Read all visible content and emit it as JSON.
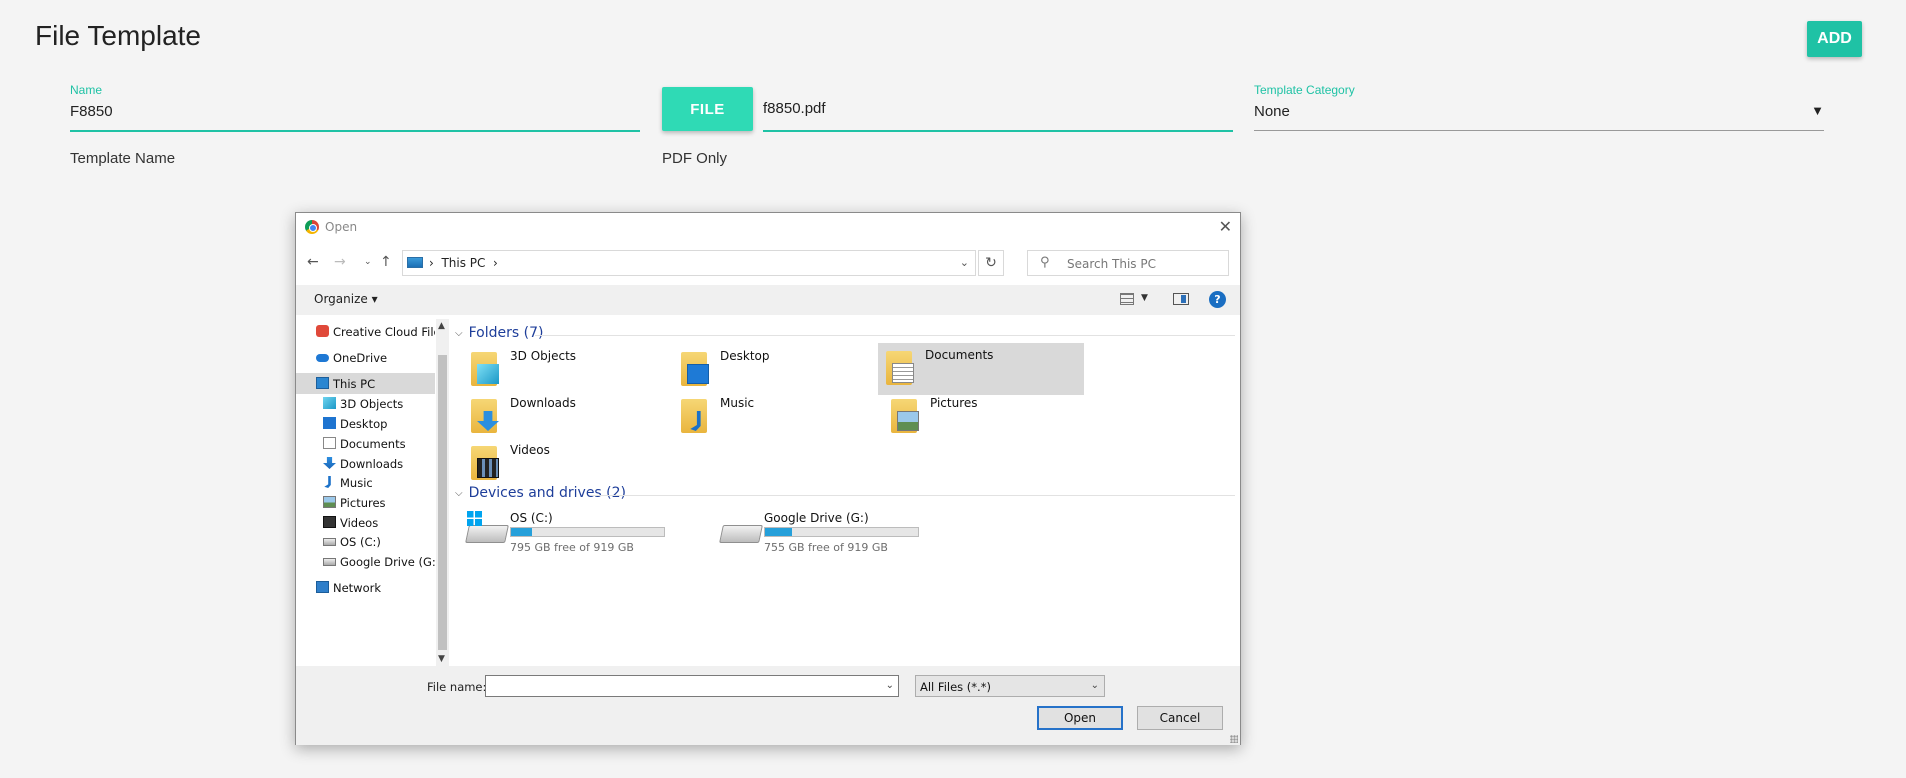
{
  "page": {
    "title": "File Template",
    "add_label": "ADD",
    "accent_color": "#1fc2a5"
  },
  "form": {
    "name_label": "Name",
    "name_value": "F8850",
    "name_hint": "Template Name",
    "file_button": "FILE",
    "file_value": "f8850.pdf",
    "file_hint": "PDF Only",
    "category_label": "Template Category",
    "category_value": "None"
  },
  "dialog": {
    "title": "Open",
    "address": "This PC",
    "search_placeholder": "Search This PC",
    "organize": "Organize",
    "nav_items": [
      {
        "label": "Creative Cloud Files",
        "icon": "creative-cloud-icon",
        "indent": false
      },
      {
        "label": "OneDrive",
        "icon": "onedrive-icon",
        "indent": false
      },
      {
        "label": "This PC",
        "icon": "computer-icon",
        "indent": false,
        "selected": true
      },
      {
        "label": "3D Objects",
        "icon": "3d-objects-icon",
        "indent": true
      },
      {
        "label": "Desktop",
        "icon": "desktop-icon",
        "indent": true
      },
      {
        "label": "Documents",
        "icon": "documents-icon",
        "indent": true
      },
      {
        "label": "Downloads",
        "icon": "downloads-icon",
        "indent": true
      },
      {
        "label": "Music",
        "icon": "music-icon",
        "indent": true
      },
      {
        "label": "Pictures",
        "icon": "pictures-icon",
        "indent": true
      },
      {
        "label": "Videos",
        "icon": "videos-icon",
        "indent": true
      },
      {
        "label": "OS (C:)",
        "icon": "drive-icon",
        "indent": true
      },
      {
        "label": "Google Drive (G:)",
        "icon": "drive-icon",
        "indent": true
      },
      {
        "label": "Network",
        "icon": "network-icon",
        "indent": false
      }
    ],
    "folders_header": "Folders (7)",
    "folders": [
      {
        "label": "3D Objects",
        "icon": "3d-objects-icon"
      },
      {
        "label": "Desktop",
        "icon": "desktop-icon"
      },
      {
        "label": "Documents",
        "icon": "documents-icon",
        "selected": true
      },
      {
        "label": "Downloads",
        "icon": "downloads-icon"
      },
      {
        "label": "Music",
        "icon": "music-icon"
      },
      {
        "label": "Pictures",
        "icon": "pictures-icon"
      },
      {
        "label": "Videos",
        "icon": "videos-icon"
      }
    ],
    "drives_header": "Devices and drives (2)",
    "drives": [
      {
        "label": "OS (C:)",
        "free_text": "795 GB free of 919 GB",
        "used_fraction": 0.135,
        "icon": "windows-drive-icon"
      },
      {
        "label": "Google Drive (G:)",
        "free_text": "755 GB free of 919 GB",
        "used_fraction": 0.178,
        "icon": "drive-icon"
      }
    ],
    "file_name_label": "File name:",
    "file_name_value": "",
    "filter_value": "All Files (*.*)",
    "open_label": "Open",
    "cancel_label": "Cancel"
  }
}
